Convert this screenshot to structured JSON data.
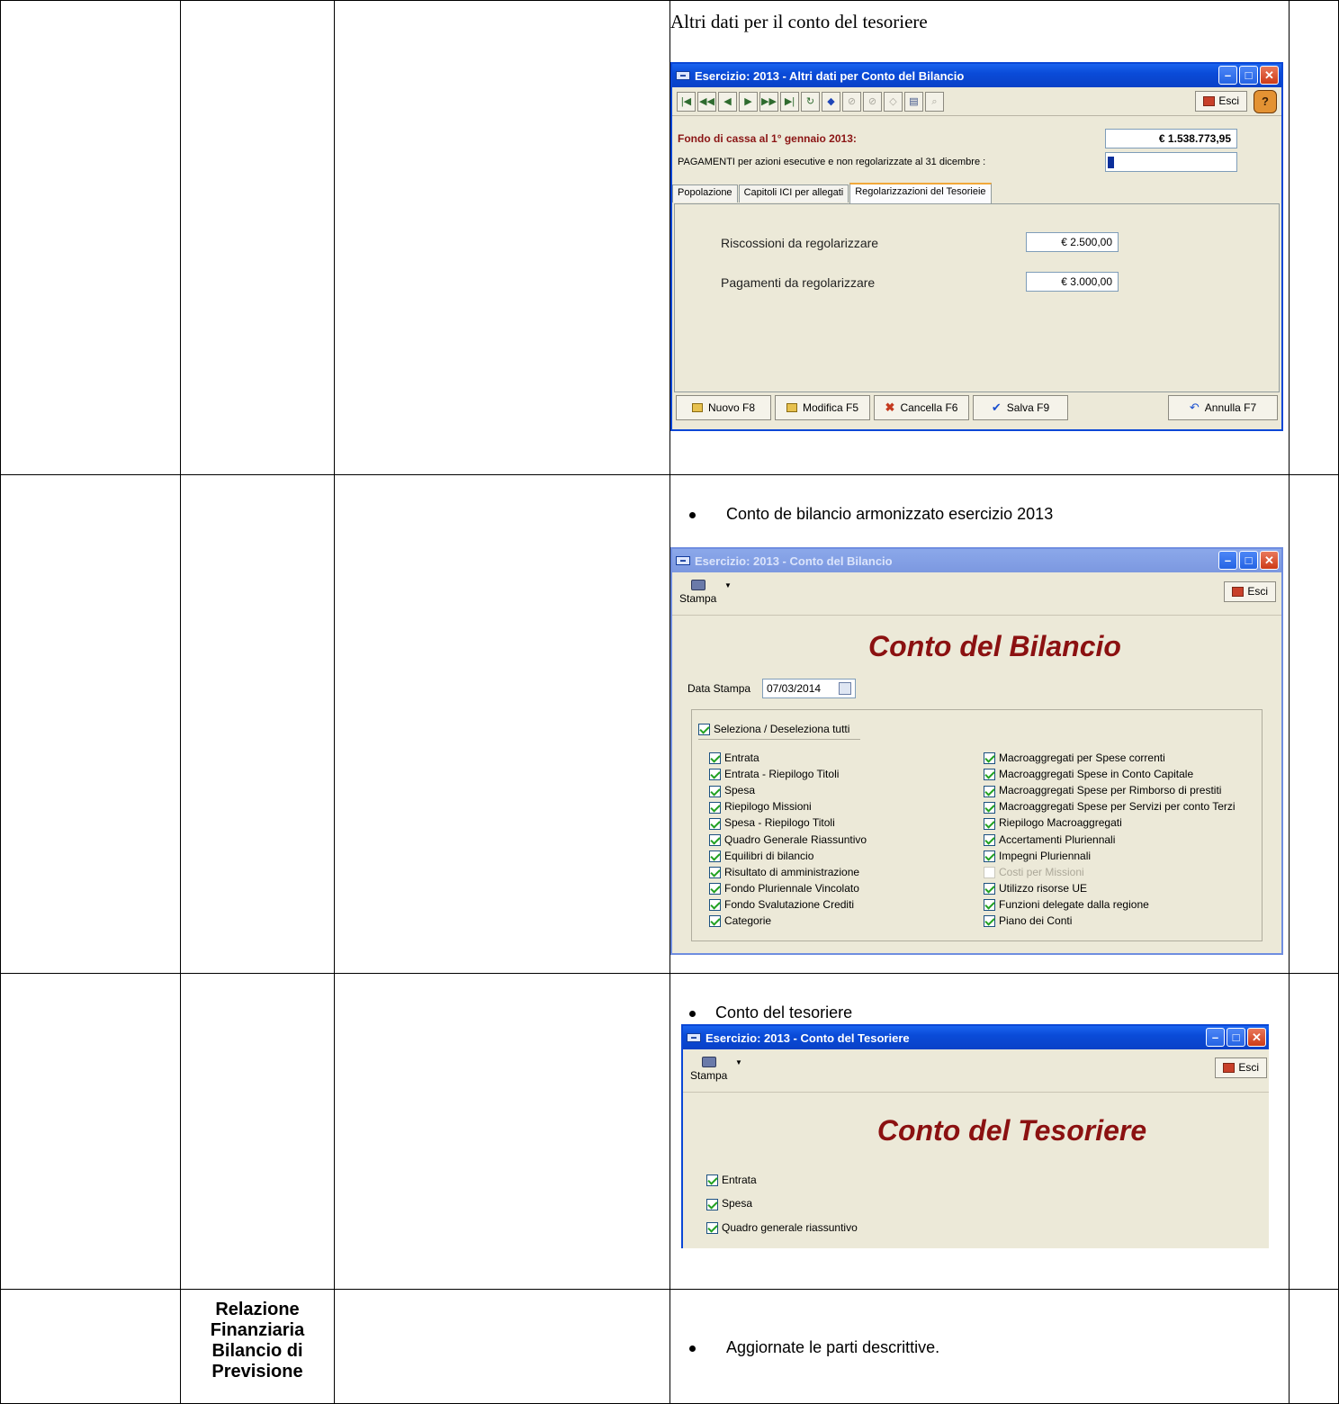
{
  "row1": {
    "heading": "Altri dati per il conto del tesoriere",
    "window": {
      "title": "Esercizio: 2013 - Altri dati per Conto del Bilancio",
      "toolbar_icons": [
        "first-record-icon",
        "prev-page-icon",
        "prev-record-icon",
        "next-record-icon",
        "next-page-icon",
        "last-record-icon",
        "refresh-icon",
        "edit-icon",
        "link-icon",
        "unlink-icon",
        "tag-icon",
        "print-icon",
        "zoom-icon"
      ],
      "esci_label": "Esci",
      "fondo_label": "Fondo di cassa al 1° gennaio 2013:",
      "fondo_value": "€ 1.538.773,95",
      "pagamenti_label": "PAGAMENTI per azioni esecutive e non regolarizzate al 31 dicembre :",
      "pagamenti_value": "0",
      "tabs": [
        "Popolazione",
        "Capitoli ICI per allegati",
        "Regolarizzazioni del Tesorieie"
      ],
      "riscossioni_label": "Riscossioni da regolarizzare",
      "riscossioni_value": "€ 2.500,00",
      "pagamenti_reg_label": "Pagamenti da regolarizzare",
      "pagamenti_reg_value": "€ 3.000,00",
      "buttons": {
        "nuovo": "Nuovo F8",
        "modifica": "Modifica F5",
        "cancella": "Cancella F6",
        "salva": "Salva F9",
        "annulla": "Annulla F7"
      }
    }
  },
  "row2": {
    "bullet": "Conto de bilancio armonizzato esercizio 2013",
    "window": {
      "title": "Esercizio: 2013 - Conto del Bilancio",
      "stampa_label": "Stampa",
      "esci_label": "Esci",
      "big_title": "Conto del Bilancio",
      "data_stampa_label": "Data Stampa",
      "data_stampa_value": "07/03/2014",
      "select_all_label": "Seleziona / Deseleziona tutti",
      "left_checks": [
        "Entrata",
        "Entrata - Riepilogo Titoli",
        "Spesa",
        "Riepilogo Missioni",
        "Spesa - Riepilogo Titoli",
        "Quadro Generale Riassuntivo",
        "Equilibri di bilancio",
        "Risultato di amministrazione",
        "Fondo Pluriennale Vincolato",
        "Fondo Svalutazione Crediti",
        "Categorie"
      ],
      "right_checks": [
        "Macroaggregati per Spese correnti",
        "Macroaggregati Spese in Conto Capitale",
        "Macroaggregati Spese per Rimborso di prestiti",
        "Macroaggregati Spese per Servizi per conto Terzi",
        "Riepilogo Macroaggregati",
        "Accertamenti Pluriennali",
        "Impegni Pluriennali",
        "Costi per Missioni",
        "Utilizzo risorse UE",
        "Funzioni delegate dalla regione",
        "Piano dei Conti"
      ]
    }
  },
  "row3": {
    "bullet": "Conto del tesoriere",
    "window": {
      "title": "Esercizio: 2013 - Conto del Tesoriere",
      "stampa_label": "Stampa",
      "esci_label": "Esci",
      "big_title": "Conto del Tesoriere",
      "checks": [
        "Entrata",
        "Spesa",
        "Quadro generale riassuntivo"
      ]
    }
  },
  "row4": {
    "label_lines": [
      "Relazione",
      "Finanziaria",
      "Bilancio di",
      "Previsione"
    ],
    "bullet": "Aggiornate le parti descrittive."
  },
  "colors": {
    "titlebar": "#0a4bd8",
    "window_bg": "#ece9d8",
    "title_red": "#8b1111"
  }
}
